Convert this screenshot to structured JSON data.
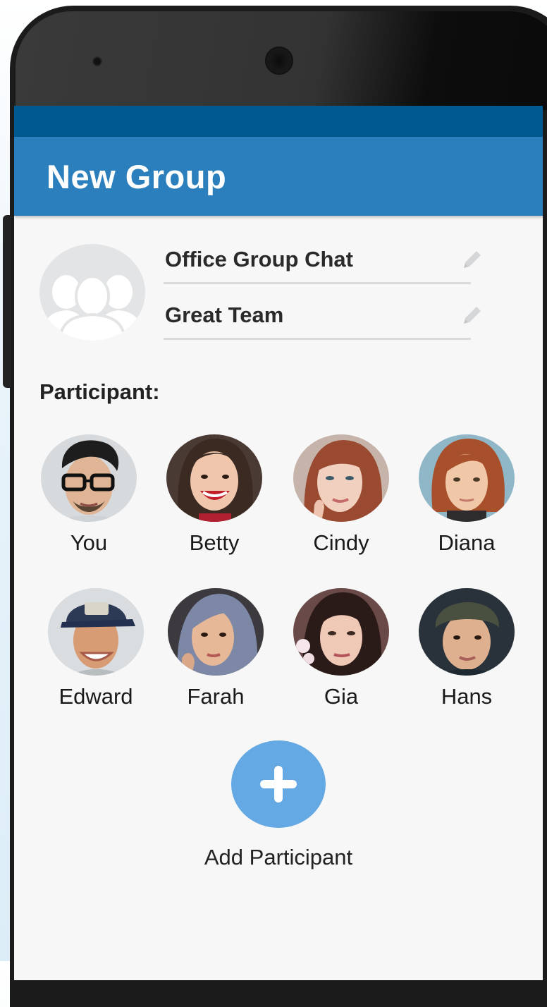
{
  "appbar": {
    "title": "New Group"
  },
  "group": {
    "name": "Office Group Chat",
    "description": "Great Team"
  },
  "participants_label": "Participant:",
  "participants": [
    {
      "name": "You"
    },
    {
      "name": "Betty"
    },
    {
      "name": "Cindy"
    },
    {
      "name": "Diana"
    },
    {
      "name": "Edward"
    },
    {
      "name": "Farah"
    },
    {
      "name": "Gia"
    },
    {
      "name": "Hans"
    }
  ],
  "add_participant": {
    "label": "Add Participant"
  },
  "colors": {
    "status_bar": "#005a8f",
    "app_bar": "#2a7fbc",
    "add_button": "#64a9e3"
  }
}
